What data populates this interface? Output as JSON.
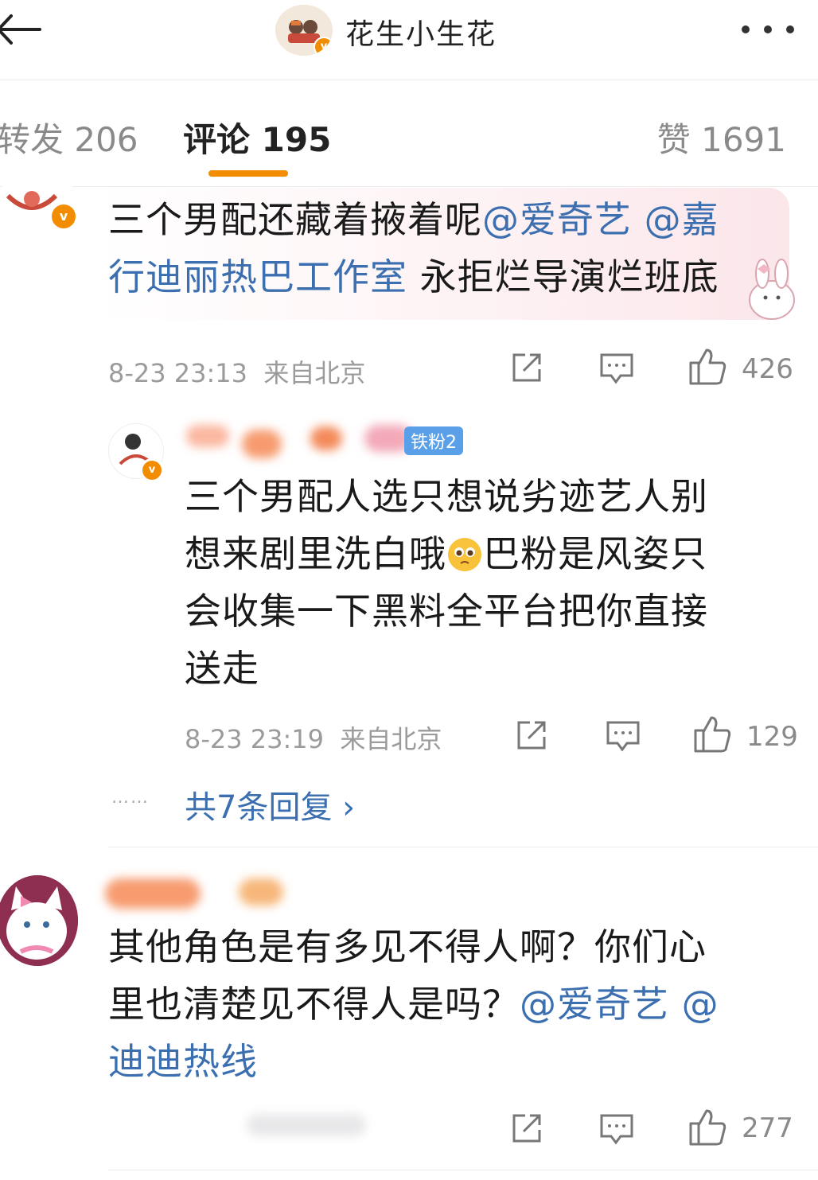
{
  "header": {
    "title": "花生小生花",
    "verified_mark": "v",
    "back_icon": "back-arrow-icon",
    "more_icon": "more-dots-icon"
  },
  "tabs": {
    "repost": "转发 206",
    "comments": "评论 195",
    "likes": "赞 1691"
  },
  "comments": [
    {
      "text_plain_1": "三个男配还藏着掖着呢",
      "mention_1": "@爱奇艺 @嘉",
      "mention_2": "行迪丽热巴工作室",
      "text_plain_2": " 永拒烂导演烂班底",
      "time": "8-23 23:13",
      "location": "来自北京",
      "likes": "426"
    },
    {
      "fan_badge": "铁粉2",
      "line1": "三个男配人选只想说劣迹艺人别",
      "line2a": "想来剧里洗白哦",
      "line2b": "巴粉是风姿只",
      "line3": "会收集一下黑料全平台把你直接",
      "line4": "送走",
      "time": "8-23 23:19",
      "location": "来自北京",
      "likes": "129",
      "more_dots": "……",
      "replies_link": "共7条回复 ›"
    },
    {
      "line1": "其他角色是有多见不得人啊？你们心",
      "line2_plain": "里也清楚见不得人是吗？",
      "line2_mention": "@爱奇艺 @",
      "line3_mention": "迪迪热线",
      "likes": "277"
    }
  ],
  "colors": {
    "accent": "#f28c00",
    "link": "#3b6fb0",
    "meta": "#9b9b9b"
  }
}
